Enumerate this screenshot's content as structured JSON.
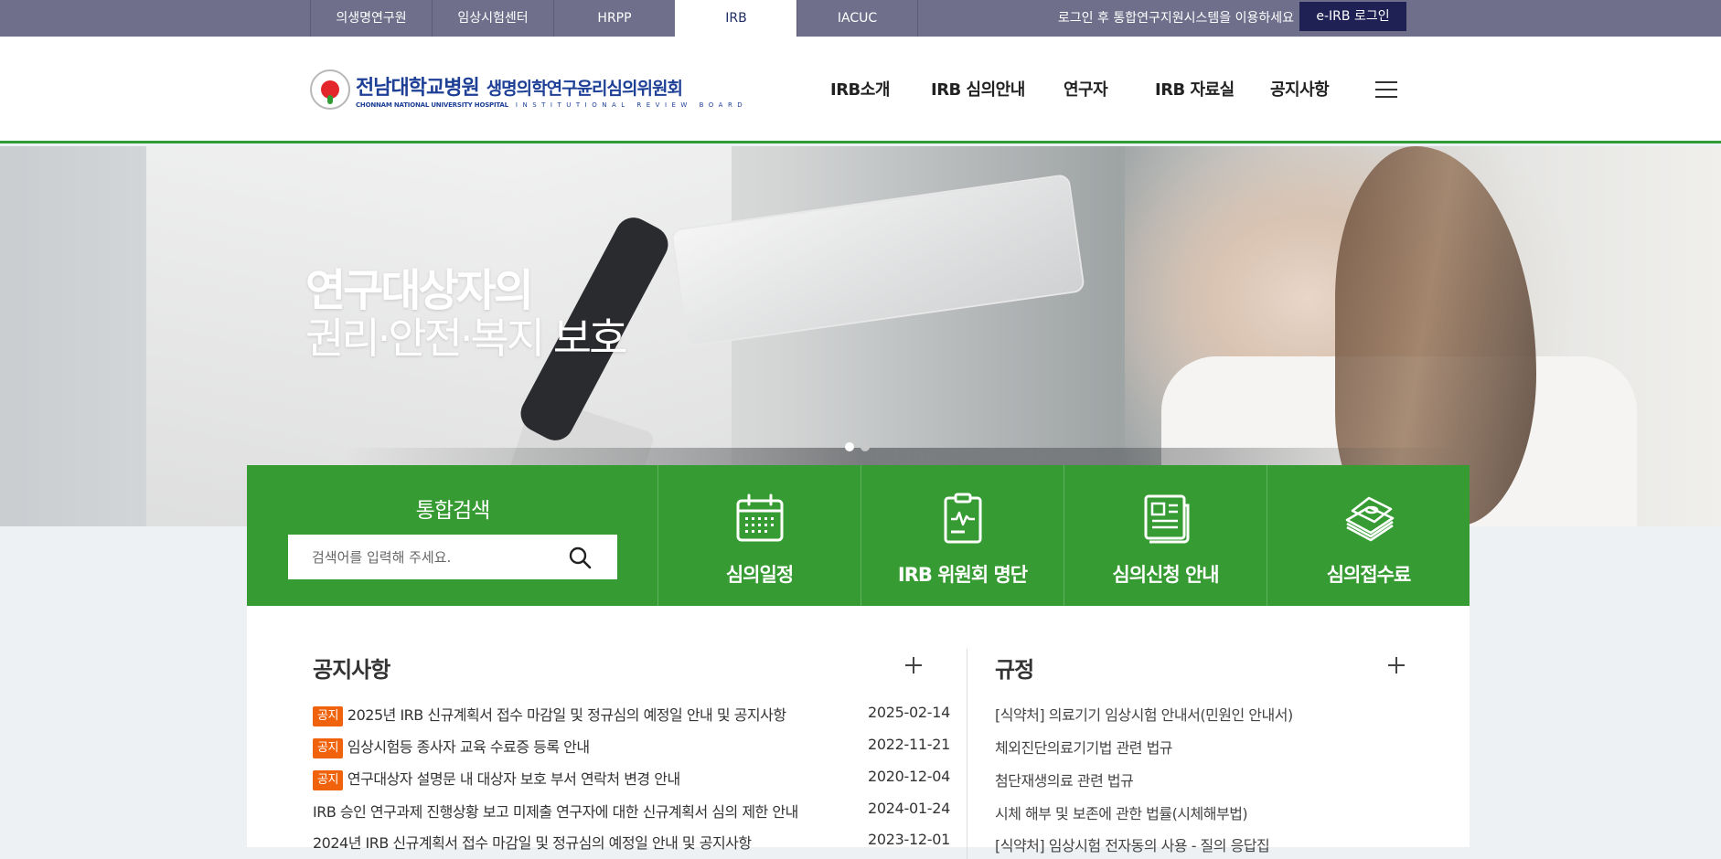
{
  "top_tabs": [
    "의생명연구원",
    "임상시험센터",
    "HRPP",
    "IRB",
    "IACUC"
  ],
  "login_message": "로그인 후 통합연구지원시스템을 이용하세요",
  "login_button": "e-IRB 로그인",
  "logo": {
    "hospital_kr": "전남대학교병원",
    "hospital_en": "CHONNAM NATIONAL UNIVERSITY HOSPITAL",
    "irb_kr": "생명의학연구윤리심의위원회",
    "irb_en": "INSTITUTIONAL REVIEW BOARD"
  },
  "gnb": [
    "IRB소개",
    "IRB 심의안내",
    "연구자",
    "IRB 자료실",
    "공지사항"
  ],
  "hero": {
    "line1": "연구대상자의",
    "line2": "권리·안전·복지 보호"
  },
  "search": {
    "title": "통합검색",
    "placeholder": "검색어를 입력해 주세요."
  },
  "quick_links": [
    "심의일정",
    "IRB 위원회 명단",
    "심의신청 안내",
    "심의접수료"
  ],
  "notice": {
    "title": "공지사항",
    "badge": "공지",
    "items": [
      {
        "title": "2025년 IRB 신규계획서 접수 마감일 및 정규심의 예정일 안내 및 공지사항",
        "date": "2025-02-14"
      },
      {
        "title": "임상시험등 종사자 교육 수료증 등록 안내",
        "date": "2022-11-21"
      },
      {
        "title": "연구대상자 설명문 내 대상자 보호 부서 연락처 변경 안내",
        "date": "2020-12-04"
      },
      {
        "title": "IRB 승인 연구과제 진행상황 보고 미제출 연구자에 대한 신규계획서 심의 제한 안내",
        "date": "2024-01-24"
      },
      {
        "title": "2024년 IRB 신규계획서 접수 마감일 및 정규심의 예정일 안내 및 공지사항",
        "date": "2023-12-01"
      }
    ]
  },
  "rules": {
    "title": "규정",
    "items": [
      "[식약처] 의료기기 임상시험 안내서(민원인 안내서)",
      "체외진단의료기기법 관련 법규",
      "첨단재생의료 관련 법규",
      "시체 해부 및 보존에 관한 법률(시체해부법)",
      "[식약처] 임상시험 전자동의 사용 - 질의 응답집"
    ]
  },
  "colors": {
    "brand_green": "#369b32",
    "top_bar": "#6f6f8b",
    "login_btn": "#1f2154",
    "notice_badge": "#f0620b"
  }
}
